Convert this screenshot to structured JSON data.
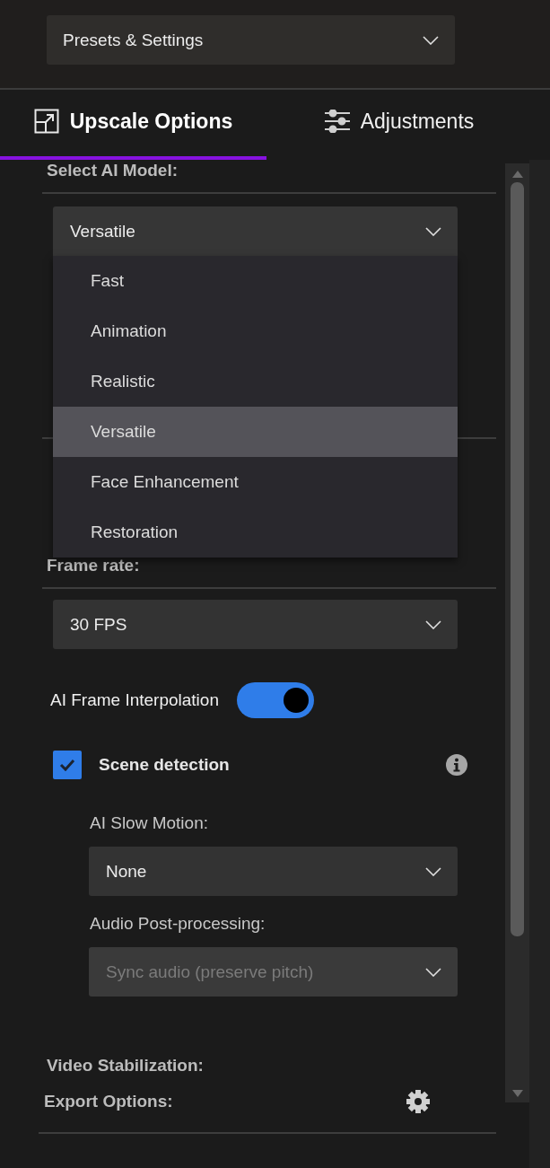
{
  "presets_dropdown": {
    "value": "Presets & Settings"
  },
  "tabs": [
    {
      "label": "Upscale Options",
      "selected": true
    },
    {
      "label": "Adjustments",
      "selected": false
    }
  ],
  "ai_model": {
    "heading": "Select AI Model:",
    "value": "Versatile",
    "expanded": true,
    "options": [
      {
        "label": "Fast",
        "selected": false
      },
      {
        "label": "Animation",
        "selected": false
      },
      {
        "label": "Realistic",
        "selected": false
      },
      {
        "label": "Versatile",
        "selected": true
      },
      {
        "label": "Face Enhancement",
        "selected": false
      },
      {
        "label": "Restoration",
        "selected": false
      }
    ]
  },
  "frame_rate": {
    "heading": "Frame rate:",
    "value": "30 FPS"
  },
  "frame_interpolation": {
    "label": "AI Frame Interpolation",
    "on": true
  },
  "scene_detection": {
    "label": "Scene detection",
    "checked": true
  },
  "slow_motion": {
    "label": "AI Slow Motion:",
    "value": "None"
  },
  "audio": {
    "label": "Audio Post-processing:",
    "value": "Sync audio (preserve pitch)",
    "disabled": true
  },
  "video_stabilization": {
    "heading": "Video Stabilization:"
  },
  "export_options": {
    "heading": "Export Options:"
  }
}
